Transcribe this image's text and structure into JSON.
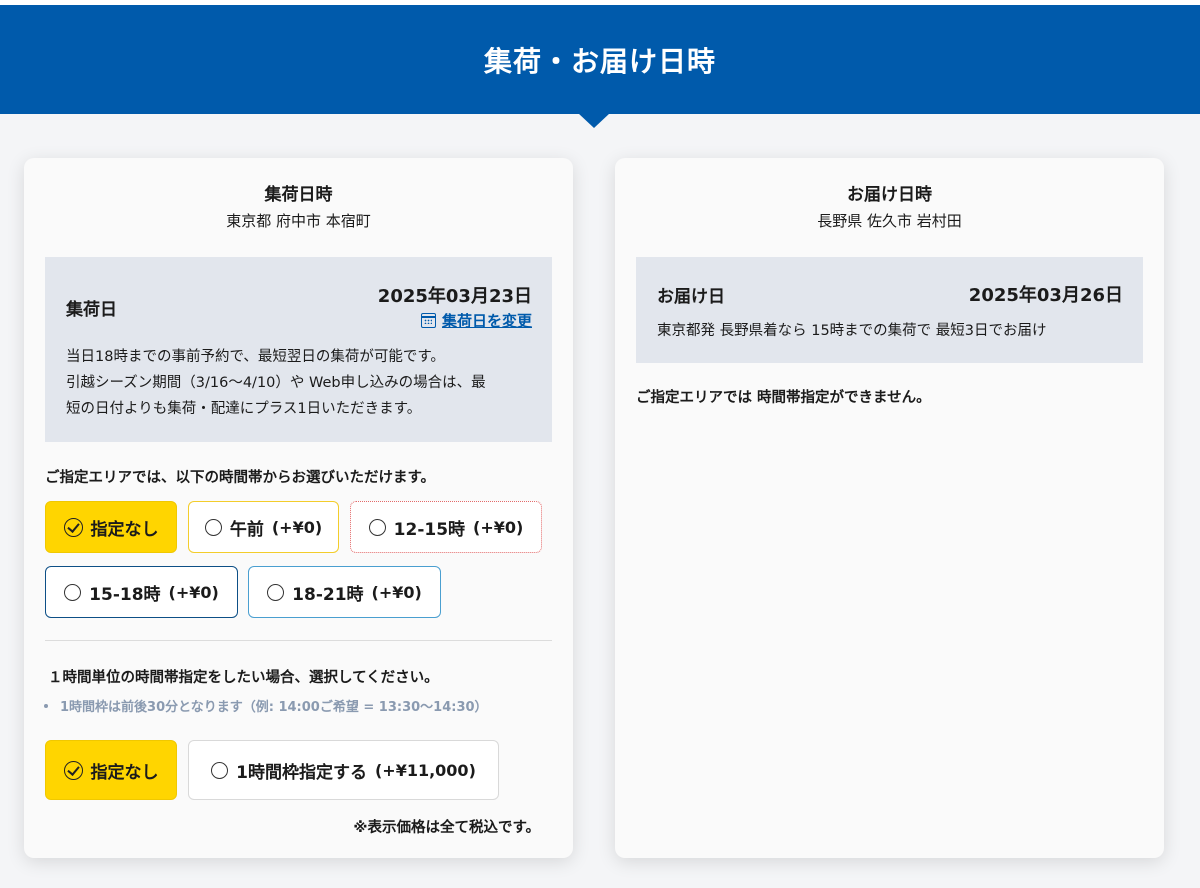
{
  "header": {
    "title": "集荷・お届け日時"
  },
  "pickup": {
    "title": "集荷日時",
    "address": "東京都 府中市 本宿町",
    "box": {
      "label": "集荷日",
      "date": "2025年03月23日",
      "change_link": "集荷日を変更",
      "lines": [
        "当日18時までの事前予約で、最短翌日の集荷が可能です。",
        "引越シーズン期間（3/16〜4/10）や Web申し込みの場合は、最",
        "短の日付よりも集荷・配達にプラス1日いただきます。"
      ]
    },
    "time_note": "ご指定エリアでは、以下の時間帯からお選びいただけます。",
    "time_options": [
      {
        "label": "指定なし",
        "price": "",
        "selected": true
      },
      {
        "label": "午前",
        "price": "(+¥0)",
        "selected": false
      },
      {
        "label": "12-15時",
        "price": "(+¥0)",
        "selected": false
      },
      {
        "label": "15-18時",
        "price": "(+¥0)",
        "selected": false
      },
      {
        "label": "18-21時",
        "price": "(+¥0)",
        "selected": false
      }
    ],
    "hourly_note": "１時間単位の時間帯指定をしたい場合、選択してください。",
    "hourly_bullet": "1時間枠は前後30分となります（例: 14:00ご希望 = 13:30〜14:30）",
    "hourly_options": [
      {
        "label": "指定なし",
        "price": "",
        "selected": true
      },
      {
        "label": "1時間枠指定する",
        "price": "(+¥11,000)",
        "selected": false
      }
    ],
    "tax_note": "※表示価格は全て税込です。"
  },
  "delivery": {
    "title": "お届け日時",
    "address": "長野県 佐久市 岩村田",
    "box": {
      "label": "お届け日",
      "date": "2025年03月26日",
      "text": "東京都発 長野県着なら 15時までの集荷で 最短3日でお届け"
    },
    "note": "ご指定エリアでは 時間帯指定ができません。"
  },
  "colors": {
    "header_bg": "#005aab",
    "selected_bg": "#ffd500",
    "link": "#005aab",
    "info_box_bg": "#e2e6ed"
  }
}
